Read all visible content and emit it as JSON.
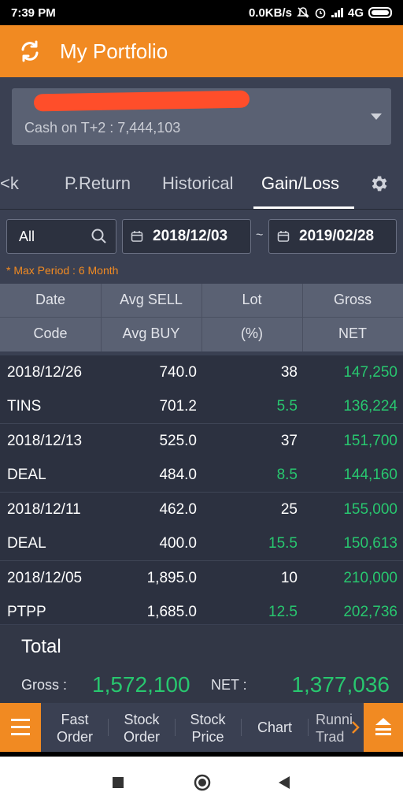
{
  "status_bar": {
    "time": "7:39 PM",
    "speed": "0.0KB/s",
    "network": "4G"
  },
  "header": {
    "title": "My Portfolio",
    "refresh_icon": "refresh-icon"
  },
  "account": {
    "cash_label": "Cash on T+2 : 7,444,103"
  },
  "tabs": [
    {
      "label": "<k",
      "active": false
    },
    {
      "label": "P.Return",
      "active": false
    },
    {
      "label": "Historical",
      "active": false
    },
    {
      "label": "Gain/Loss",
      "active": true
    }
  ],
  "filters": {
    "stock": "All",
    "date_from": "2018/12/03",
    "separator": "~",
    "date_to": "2019/02/28",
    "max_period_note": "* Max Period : 6 Month"
  },
  "table": {
    "headers_row1": [
      "Date",
      "Avg SELL",
      "Lot",
      "Gross"
    ],
    "headers_row2": [
      "Code",
      "Avg BUY",
      "(%)",
      "NET"
    ],
    "rows": [
      {
        "a": "2018/12/26",
        "b": "740.0",
        "c": "38",
        "d": "147,250",
        "c_green": false
      },
      {
        "a": "TINS",
        "b": "701.2",
        "c": "5.5",
        "d": "136,224",
        "c_green": true
      },
      {
        "a": "2018/12/13",
        "b": "525.0",
        "c": "37",
        "d": "151,700",
        "c_green": false
      },
      {
        "a": "DEAL",
        "b": "484.0",
        "c": "8.5",
        "d": "144,160",
        "c_green": true
      },
      {
        "a": "2018/12/11",
        "b": "462.0",
        "c": "25",
        "d": "155,000",
        "c_green": false
      },
      {
        "a": "DEAL",
        "b": "400.0",
        "c": "15.5",
        "d": "150,613",
        "c_green": true
      },
      {
        "a": "2018/12/05",
        "b": "1,895.0",
        "c": "10",
        "d": "210,000",
        "c_green": false
      },
      {
        "a": "PTPP",
        "b": "1,685.0",
        "c": "12.5",
        "d": "202,736",
        "c_green": true
      }
    ]
  },
  "total": {
    "title": "Total",
    "gross_label": "Gross :",
    "gross_value": "1,572,100",
    "net_label": "NET :",
    "net_value": "1,377,036"
  },
  "bottom_nav": {
    "items": [
      {
        "line1": "Fast",
        "line2": "Order"
      },
      {
        "line1": "Stock",
        "line2": "Order"
      },
      {
        "line1": "Stock",
        "line2": "Price"
      },
      {
        "line1": "Chart",
        "line2": ""
      },
      {
        "line1": "Runni",
        "line2": "Trad"
      }
    ]
  },
  "colors": {
    "accent": "#f18a22",
    "gain": "#28c76f",
    "background": "#3a4052"
  }
}
